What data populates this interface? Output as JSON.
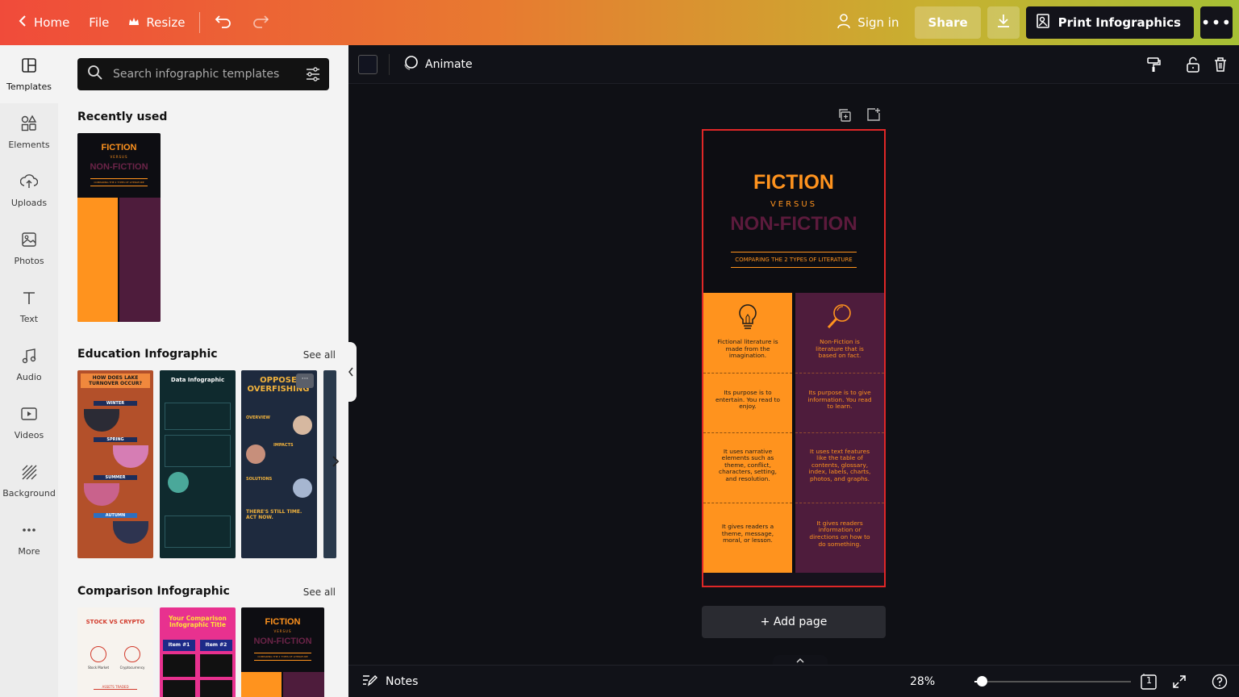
{
  "topbar": {
    "home": "Home",
    "file": "File",
    "resize": "Resize",
    "sign_in": "Sign in",
    "share": "Share",
    "print": "Print Infographics"
  },
  "rail": [
    {
      "label": "Templates",
      "icon": "templates-icon"
    },
    {
      "label": "Elements",
      "icon": "elements-icon"
    },
    {
      "label": "Uploads",
      "icon": "uploads-icon"
    },
    {
      "label": "Photos",
      "icon": "photos-icon"
    },
    {
      "label": "Text",
      "icon": "text-icon"
    },
    {
      "label": "Audio",
      "icon": "audio-icon"
    },
    {
      "label": "Videos",
      "icon": "videos-icon"
    },
    {
      "label": "Background",
      "icon": "background-icon"
    },
    {
      "label": "More",
      "icon": "more-icon"
    }
  ],
  "panel": {
    "search_placeholder": "Search infographic templates",
    "recently_used": "Recently used",
    "education": "Education Infographic",
    "comparison": "Comparison Infographic",
    "see_all": "See all"
  },
  "canvas_toolbar": {
    "animate": "Animate"
  },
  "design": {
    "title": "FICTION",
    "versus": "VERSUS",
    "title2": "NON-FICTION",
    "subtitle": "COMPARING THE 2 TYPES OF LITERATURE",
    "left": [
      "Fictional literature is made from the imagination.",
      "Its purpose is to entertain. You read to enjoy.",
      "It uses narrative elements such as theme, conflict, characters, setting, and resolution.",
      "It gives readers a theme, message, moral, or lesson."
    ],
    "right": [
      "Non-Fiction is literature that is based on fact.",
      "Its purpose is to give information. You read to learn.",
      "It uses text features like the table of contents, glossary, index, labels, charts, photos, and graphs.",
      "It gives readers information or directions on how to do something."
    ]
  },
  "add_page": "+ Add page",
  "bottombar": {
    "notes": "Notes",
    "zoom": "28%",
    "zoom_value": 28,
    "page": "1"
  },
  "thumbs": {
    "edu1_title": "HOW DOES LAKE TURNOVER OCCUR?",
    "edu1_seasons": [
      "WINTER",
      "SPRING",
      "SUMMER",
      "AUTUMN"
    ],
    "edu2_title": "Data Infographic",
    "edu3_title": "OPPOSE OVERFISHING",
    "edu3_sections": [
      "OVERVIEW",
      "IMPACTS",
      "SOLUTIONS",
      "THERE'S STILL TIME. ACT NOW."
    ],
    "cmp1_title": "STOCK VS CRYPTO",
    "cmp1_labels": [
      "Stock Market",
      "Cryptocurrency",
      "ASSETS TRADED"
    ],
    "cmp2_title": "Your Comparison Infographic Title",
    "cmp2_items": [
      "Item #1",
      "Item #2"
    ],
    "cmp3_title": "FICTION",
    "cmp3_versus": "VERSUS",
    "cmp3_title2": "NON-FICTION",
    "cmp3_sub": "COMPARING THE 2 TYPES OF LITERATURE"
  },
  "colors": {
    "orange": "#ff931e",
    "plum": "#4e1c3c",
    "dark": "#0d0d12",
    "selection": "#e02727"
  }
}
